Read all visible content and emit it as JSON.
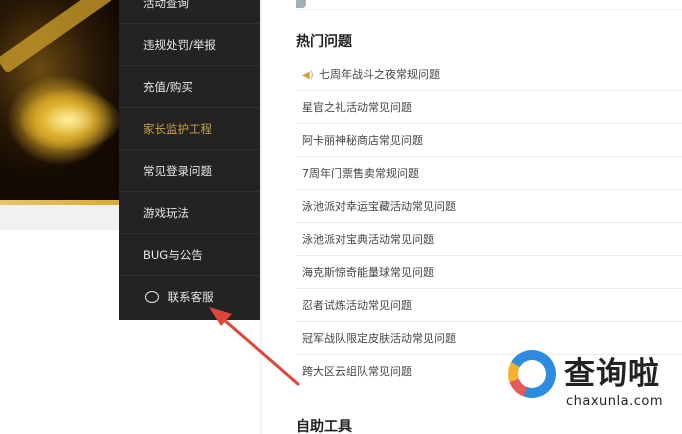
{
  "sidebar": {
    "items": [
      {
        "label": "活动查询",
        "active": false
      },
      {
        "label": "违规处罚/举报",
        "active": false
      },
      {
        "label": "充值/购买",
        "active": false
      },
      {
        "label": "家长监护工程",
        "active": true
      },
      {
        "label": "常见登录问题",
        "active": false
      },
      {
        "label": "游戏玩法",
        "active": false
      },
      {
        "label": "BUG与公告",
        "active": false
      },
      {
        "label": "联系客服",
        "active": false,
        "icon": "chat-bubble-icon"
      }
    ]
  },
  "hot_questions": {
    "title": "热门问题",
    "items": [
      {
        "label": "七周年战斗之夜常规问题",
        "icon": "speaker-icon"
      },
      {
        "label": "星官之礼活动常见问题"
      },
      {
        "label": "阿卡丽神秘商店常见问题"
      },
      {
        "label": "7周年门票售卖常规问题"
      },
      {
        "label": "泳池派对幸运宝藏活动常见问题"
      },
      {
        "label": "泳池派对宝典活动常见问题"
      },
      {
        "label": "海克斯惊奇能量球常见问题"
      },
      {
        "label": "忍者试炼活动常见问题"
      },
      {
        "label": "冠军战队限定皮肤活动常见问题"
      },
      {
        "label": "跨大区云组队常见问题"
      }
    ]
  },
  "self_help": {
    "title": "自助工具"
  },
  "watermark": {
    "title": "查询啦",
    "domain": "chaxunla.com"
  },
  "colors": {
    "sidebar_bg": "#232323",
    "active_item": "#c9a04a",
    "arrow": "#e0453a"
  }
}
